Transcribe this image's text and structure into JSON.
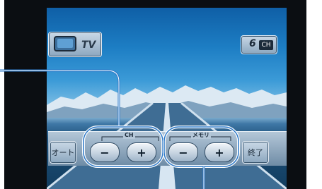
{
  "tv_button": {
    "icon": "tv-screen-icon",
    "label": "TV"
  },
  "channel_display": {
    "number": "6",
    "unit": "CH"
  },
  "bottom_bar": {
    "auto_label": "オート",
    "ch_group_label": "CH",
    "memory_group_label": "メモリ",
    "minus_symbol": "−",
    "plus_symbol": "+",
    "end_label": "終了"
  },
  "colors": {
    "callout_line": "#2b78c8",
    "highlight_ring": "#ffffff"
  }
}
